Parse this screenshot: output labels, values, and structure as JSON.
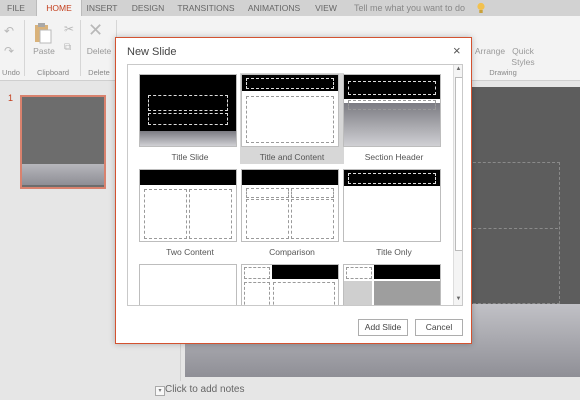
{
  "ribbon": {
    "tabs": [
      "FILE",
      "HOME",
      "INSERT",
      "DESIGN",
      "TRANSITIONS",
      "ANIMATIONS",
      "VIEW"
    ],
    "active_tab": "HOME",
    "tell_me_placeholder": "Tell me what you want to do",
    "buttons": {
      "paste": "Paste",
      "delete": "Delete",
      "arrange": "Arrange",
      "quick_styles": "Quick Styles"
    },
    "groups": {
      "undo": "Undo",
      "clipboard": "Clipboard",
      "delete": "Delete",
      "drawing": "Drawing"
    }
  },
  "thumbnails": {
    "slide_number": "1"
  },
  "notes": {
    "placeholder": "Click to add notes"
  },
  "dialog": {
    "title": "New Slide",
    "close_glyph": "×",
    "layouts": [
      "Title Slide",
      "Title and Content",
      "Section Header",
      "Two Content",
      "Comparison",
      "Title Only"
    ],
    "selected_layout": "Title and Content",
    "add_button": "Add Slide",
    "cancel_button": "Cancel",
    "scroll_up": "▲",
    "scroll_down": "▼"
  },
  "icons": [
    "undo-icon",
    "redo-icon",
    "paste-icon",
    "cut-icon",
    "copy-icon",
    "delete-icon",
    "lightbulb-icon",
    "close-icon"
  ],
  "colors": {
    "accent": "#c43e1c",
    "dialog_border": "#d35230",
    "selected_cell": "#d7d7d7"
  }
}
